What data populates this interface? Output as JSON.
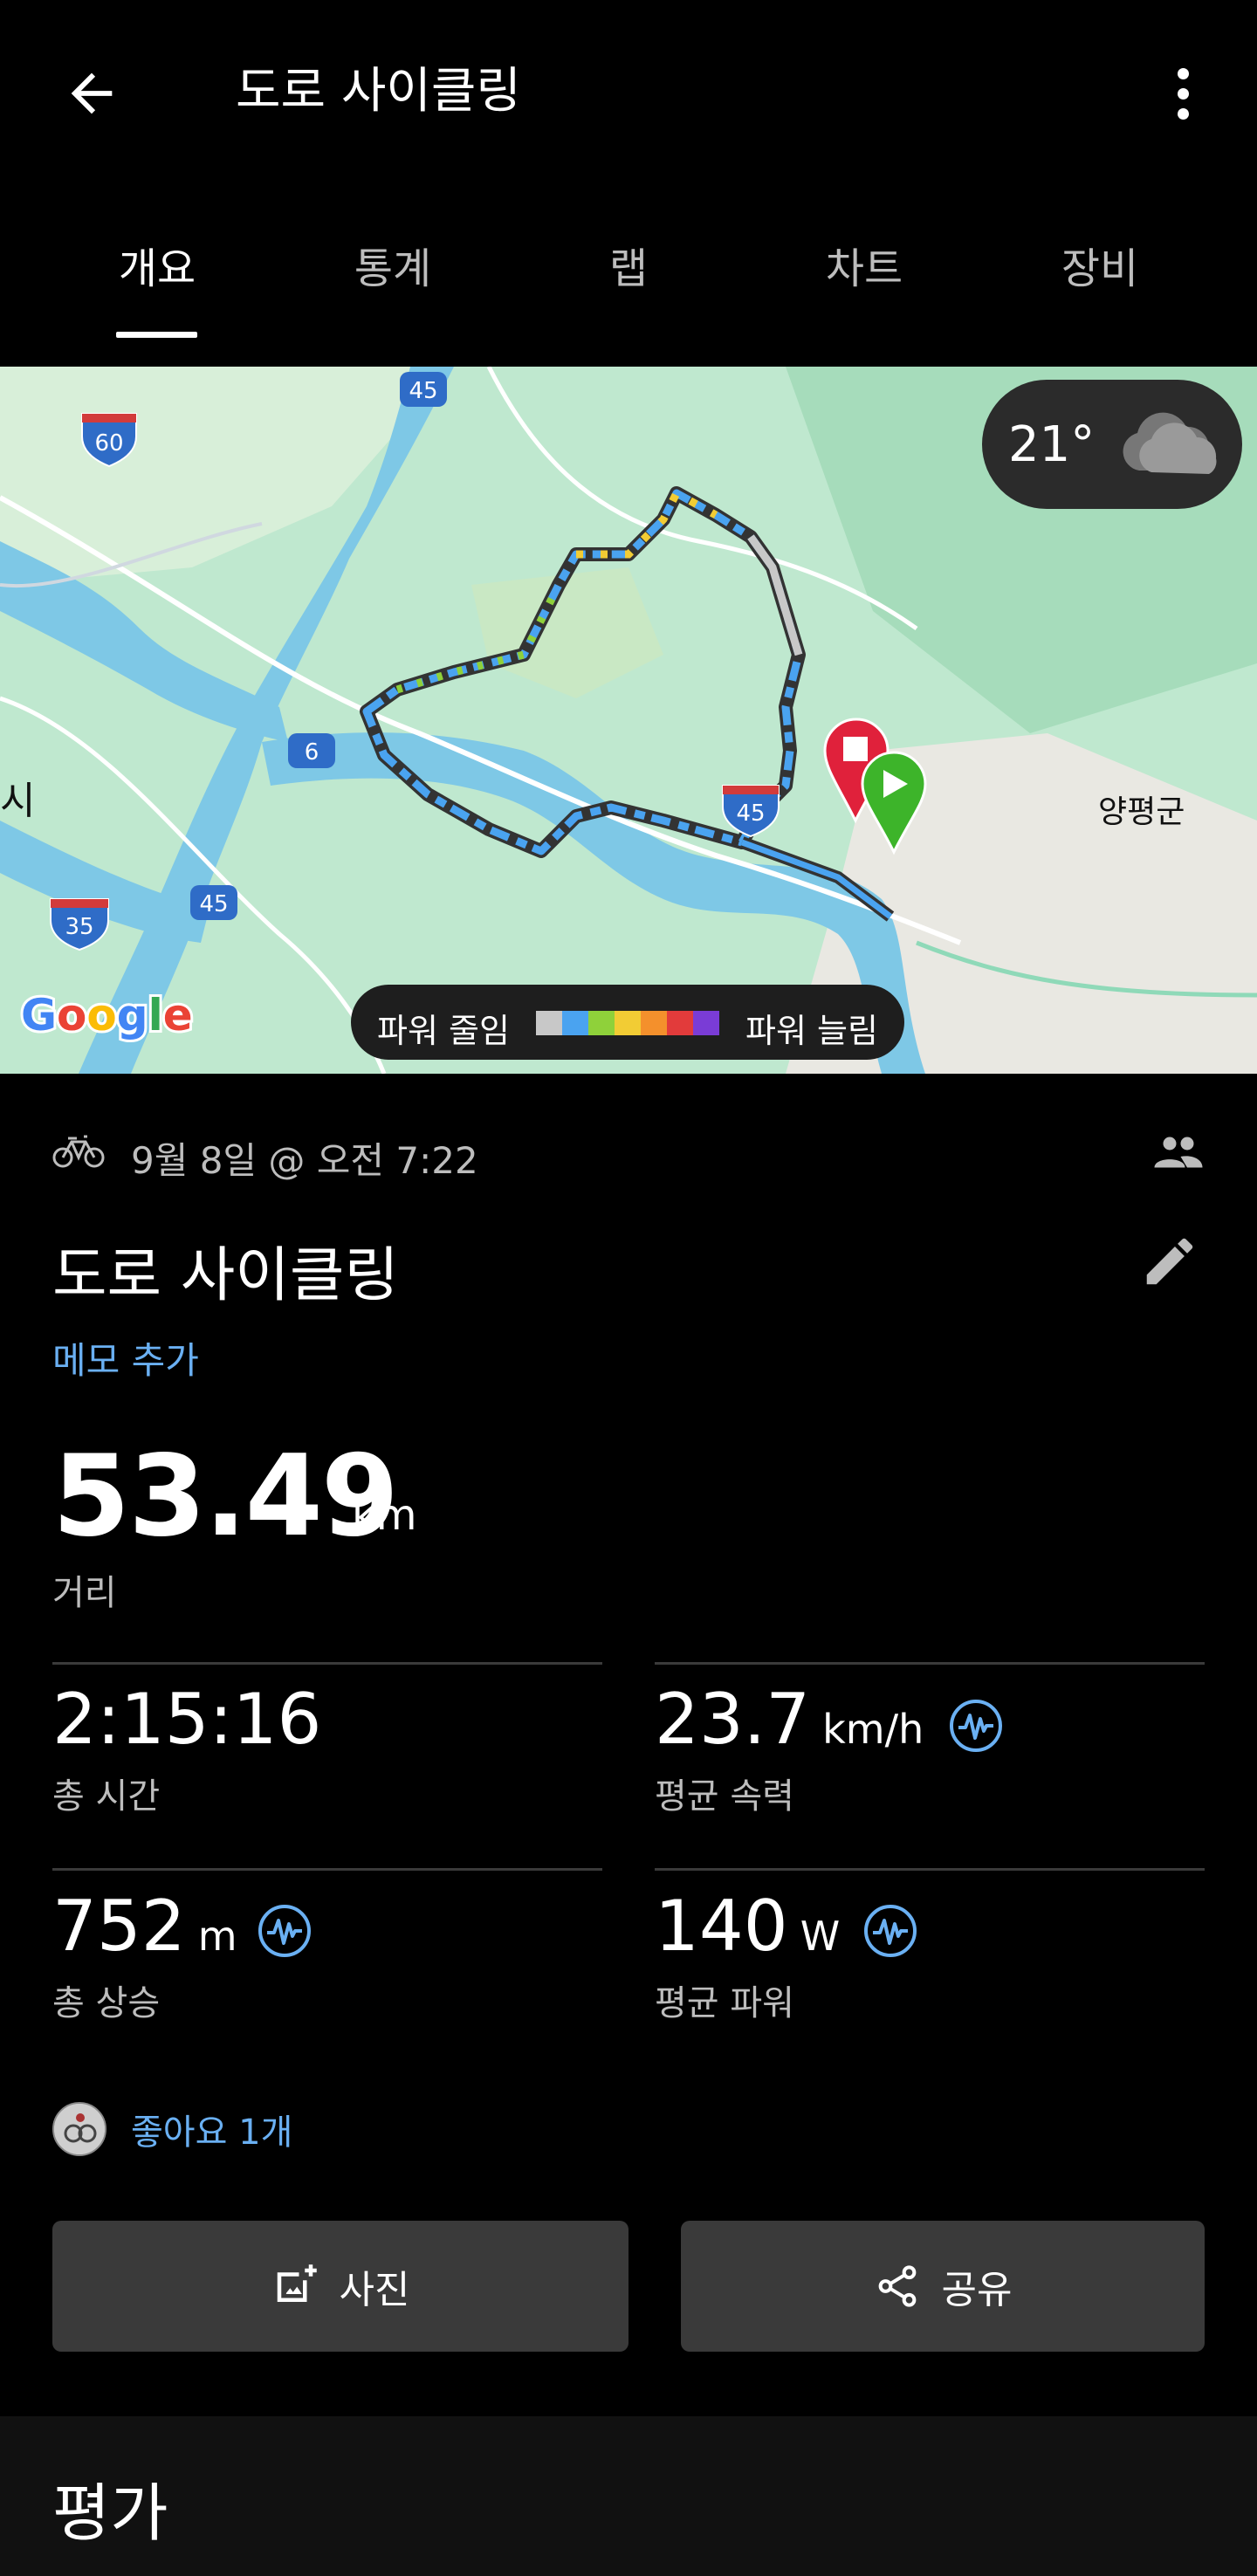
{
  "header": {
    "title": "도로 사이클링",
    "back_icon": "back-arrow-icon",
    "more_icon": "more-vertical-icon"
  },
  "tabs": [
    {
      "label": "개요",
      "active": true
    },
    {
      "label": "통계",
      "active": false
    },
    {
      "label": "랩",
      "active": false
    },
    {
      "label": "차트",
      "active": false
    },
    {
      "label": "장비",
      "active": false
    }
  ],
  "map": {
    "weather": {
      "temp": "21°",
      "icon": "cloud-icon"
    },
    "place_labels": {
      "yangpyeong": "양평군",
      "si": "시"
    },
    "highway_shields": [
      "45",
      "60",
      "6",
      "45",
      "35",
      "45"
    ],
    "logo": "Google",
    "legend": {
      "left": "파워 줄임",
      "right": "파워 늘림",
      "colors": [
        "#c8c8c8",
        "#4aa3f0",
        "#8fd13a",
        "#f2cc34",
        "#f4902c",
        "#e23b3b",
        "#7a3cd6"
      ]
    }
  },
  "activity": {
    "sport_icon": "bicycle-icon",
    "date": "9월 8일 @ 오전 7:22",
    "title": "도로 사이클링",
    "memo_link": "메모 추가",
    "distance": {
      "value": "53.49",
      "unit": "km",
      "label": "거리"
    }
  },
  "stats": [
    {
      "value": "2:15:16",
      "unit": "",
      "label": "총 시간",
      "pulse": false
    },
    {
      "value": "23.7",
      "unit": "km/h",
      "label": "평균 속력",
      "pulse": true
    },
    {
      "value": "752",
      "unit": "m",
      "label": "총 상승",
      "pulse": true
    },
    {
      "value": "140",
      "unit": "W",
      "label": "평균 파워",
      "pulse": true
    }
  ],
  "likes": {
    "text": "좋아요 1개"
  },
  "buttons": {
    "photo": "사진",
    "share": "공유"
  },
  "evaluation": {
    "title": "평가"
  },
  "colors": {
    "accent": "#6ab0f3",
    "background": "#000000",
    "button": "#3a3a3a"
  }
}
